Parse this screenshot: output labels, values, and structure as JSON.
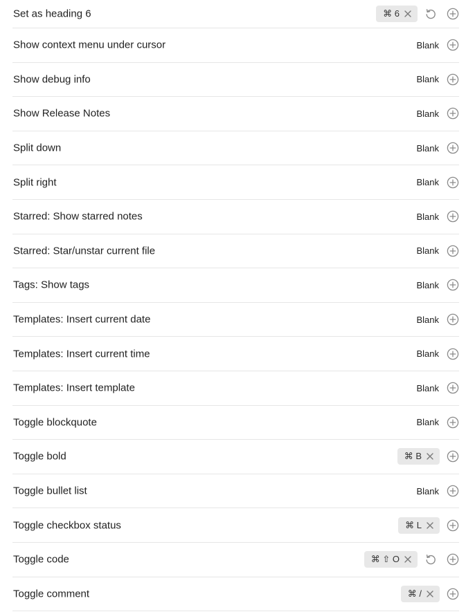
{
  "hotkeys": [
    {
      "name": "Set as heading 6",
      "keys": [
        "⌘ 6"
      ],
      "restore": true
    },
    {
      "name": "Show context menu under cursor",
      "blank": "Blank"
    },
    {
      "name": "Show debug info",
      "blank": "Blank"
    },
    {
      "name": "Show Release Notes",
      "blank": "Blank"
    },
    {
      "name": "Split down",
      "blank": "Blank"
    },
    {
      "name": "Split right",
      "blank": "Blank"
    },
    {
      "name": "Starred: Show starred notes",
      "blank": "Blank"
    },
    {
      "name": "Starred: Star/unstar current file",
      "blank": "Blank"
    },
    {
      "name": "Tags: Show tags",
      "blank": "Blank"
    },
    {
      "name": "Templates: Insert current date",
      "blank": "Blank"
    },
    {
      "name": "Templates: Insert current time",
      "blank": "Blank"
    },
    {
      "name": "Templates: Insert template",
      "blank": "Blank"
    },
    {
      "name": "Toggle blockquote",
      "blank": "Blank"
    },
    {
      "name": "Toggle bold",
      "keys": [
        "⌘ B"
      ],
      "restore": false
    },
    {
      "name": "Toggle bullet list",
      "blank": "Blank"
    },
    {
      "name": "Toggle checkbox status",
      "keys": [
        "⌘ L"
      ],
      "restore": false
    },
    {
      "name": "Toggle code",
      "keys": [
        "⌘ ⇧ O"
      ],
      "restore": true
    },
    {
      "name": "Toggle comment",
      "keys": [
        "⌘ /"
      ],
      "restore": false
    }
  ],
  "icons": {
    "remove": "close-icon",
    "restore": "restore-default-icon",
    "add": "plus-circle-icon"
  },
  "colors": {
    "hotkey_bg": "#e8e8e8",
    "icon": "#8a8a8a",
    "divider": "#e6e6e6"
  }
}
